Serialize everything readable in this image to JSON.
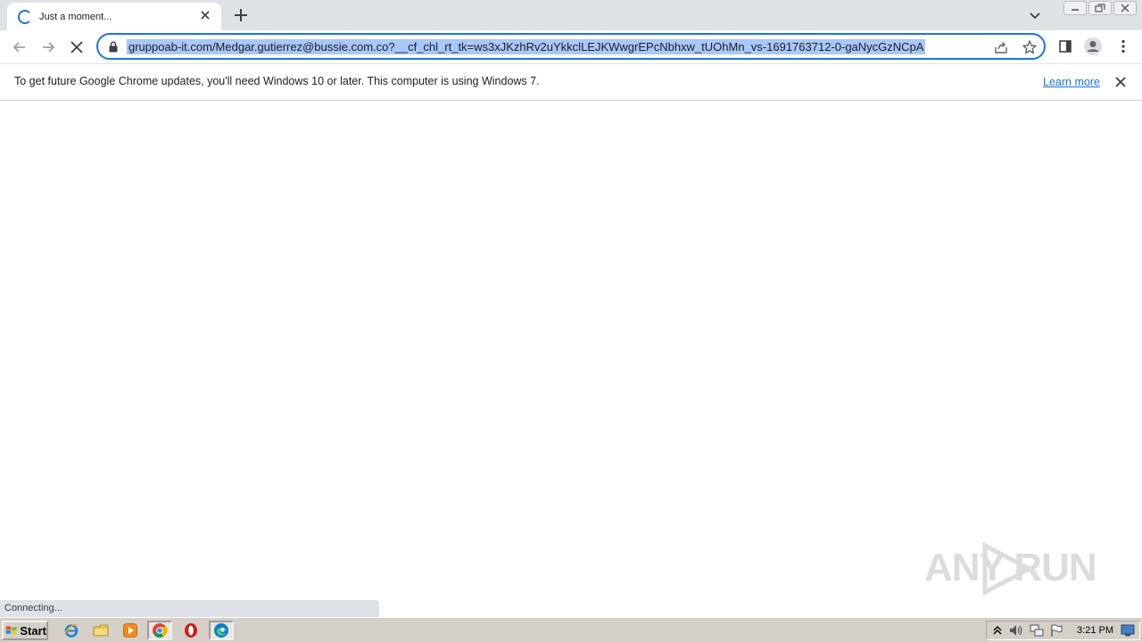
{
  "browser": {
    "tab": {
      "title": "Just a moment..."
    },
    "address_bar": {
      "url": "gruppoab-it.com/Medgar.gutierrez@bussie.com.co?__cf_chl_rt_tk=ws3xJKzhRv2uYkkclLEJKWwgrEPcNbhxw_tUOhMn_vs-1691763712-0-gaNycGzNCpA"
    },
    "infobar": {
      "message": "To get future Google Chrome updates, you'll need Windows 10 or later. This computer is using Windows 7.",
      "link_label": "Learn more"
    },
    "status_text": "Connecting..."
  },
  "watermark": {
    "text": "ANY RUN"
  },
  "taskbar": {
    "start_label": "Start",
    "clock": "3:21 PM"
  },
  "colors": {
    "accent": "#1a73e8",
    "url_selection": "#a8c7fa",
    "tabstrip": "#dee1e6",
    "taskbar": "#d4d0c8"
  }
}
